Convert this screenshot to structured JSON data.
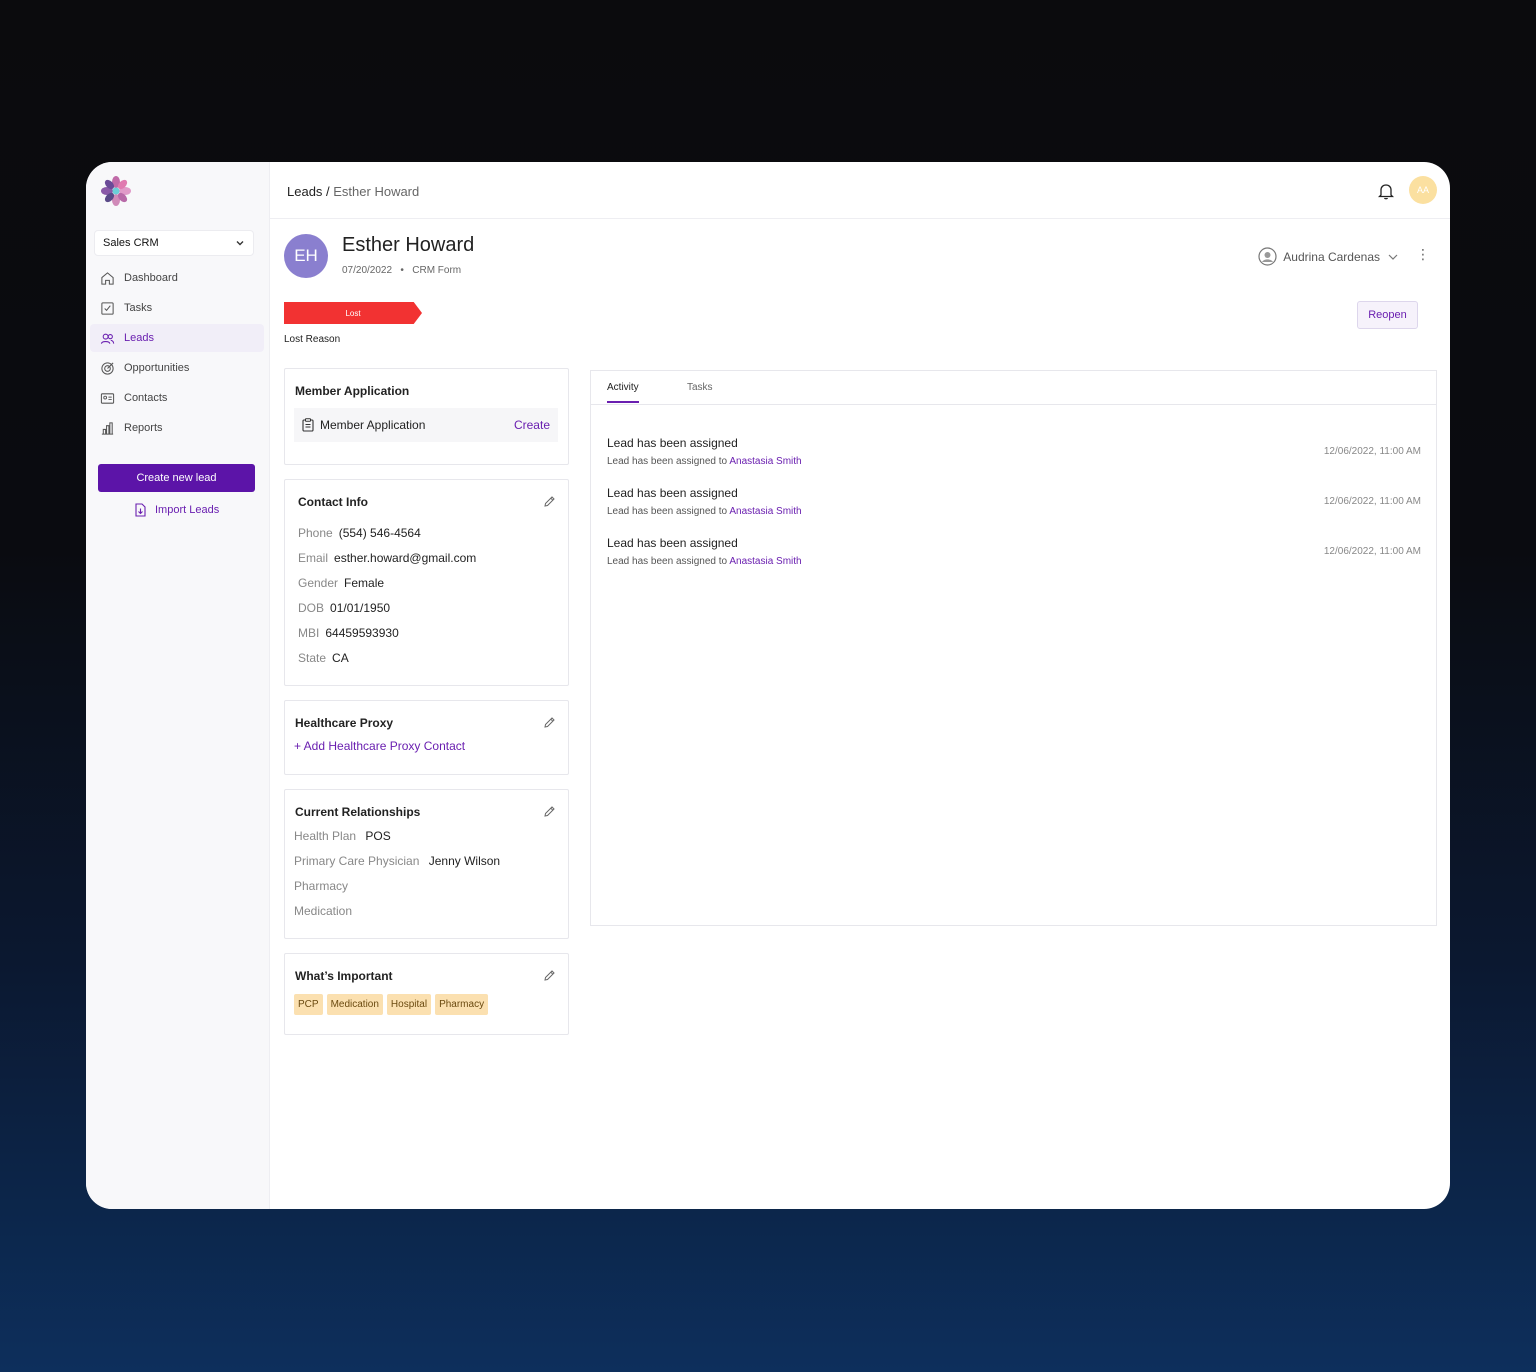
{
  "app": {
    "workspace": "Sales CRM"
  },
  "sidebar": {
    "items": [
      {
        "label": "Dashboard",
        "icon": "home-icon"
      },
      {
        "label": "Tasks",
        "icon": "tasks-icon"
      },
      {
        "label": "Leads",
        "icon": "leads-icon",
        "active": true
      },
      {
        "label": "Opportunities",
        "icon": "target-icon"
      },
      {
        "label": "Contacts",
        "icon": "contact-card-icon"
      },
      {
        "label": "Reports",
        "icon": "bar-chart-icon"
      }
    ],
    "create_label": "Create new lead",
    "import_label": "Import Leads"
  },
  "header": {
    "breadcrumb_root": "Leads",
    "breadcrumb_sep": " / ",
    "breadcrumb_current": "Esther Howard",
    "user_initials": "AA"
  },
  "lead": {
    "initials": "EH",
    "name": "Esther Howard",
    "date": "07/20/2022",
    "source": "CRM Form",
    "owner": "Audrina Cardenas",
    "status": "Lost",
    "lost_reason_label": "Lost Reason",
    "reopen_label": "Reopen"
  },
  "member_application": {
    "title": "Member Application",
    "item": "Member Application",
    "action": "Create"
  },
  "contact_info": {
    "title": "Contact Info",
    "fields": [
      {
        "label": "Phone",
        "value": "(554) 546-4564"
      },
      {
        "label": "Email",
        "value": "esther.howard@gmail.com"
      },
      {
        "label": "Gender",
        "value": "Female"
      },
      {
        "label": "DOB",
        "value": "01/01/1950"
      },
      {
        "label": "MBI",
        "value": "64459593930"
      },
      {
        "label": "State",
        "value": "CA"
      }
    ]
  },
  "healthcare_proxy": {
    "title": "Healthcare Proxy",
    "add_label": "+ Add Healthcare Proxy Contact"
  },
  "relationships": {
    "title": "Current Relationships",
    "fields": [
      {
        "label": "Health Plan",
        "value": "POS"
      },
      {
        "label": "Primary Care Physician",
        "value": "Jenny Wilson"
      },
      {
        "label": "Pharmacy",
        "value": ""
      },
      {
        "label": "Medication",
        "value": ""
      }
    ]
  },
  "whats_important": {
    "title": "What’s Important",
    "tags": [
      "PCP",
      "Medication",
      "Hospital",
      "Pharmacy"
    ]
  },
  "activity": {
    "tabs": [
      "Activity",
      "Tasks"
    ],
    "entries": [
      {
        "title": "Lead has been assigned",
        "text": "Lead has been assigned to",
        "who": "Anastasia Smith",
        "time": "12/06/2022, 11:00 AM"
      },
      {
        "title": "Lead has been assigned",
        "text": "Lead has been assigned to",
        "who": "Anastasia Smith",
        "time": "12/06/2022, 11:00 AM"
      },
      {
        "title": "Lead has been assigned",
        "text": "Lead has been assigned to",
        "who": "Anastasia Smith",
        "time": "12/06/2022, 11:00 AM"
      }
    ]
  },
  "colors": {
    "accent": "#5c14a8",
    "lost": "#f23232",
    "tag_bg": "#fbe0b0"
  }
}
